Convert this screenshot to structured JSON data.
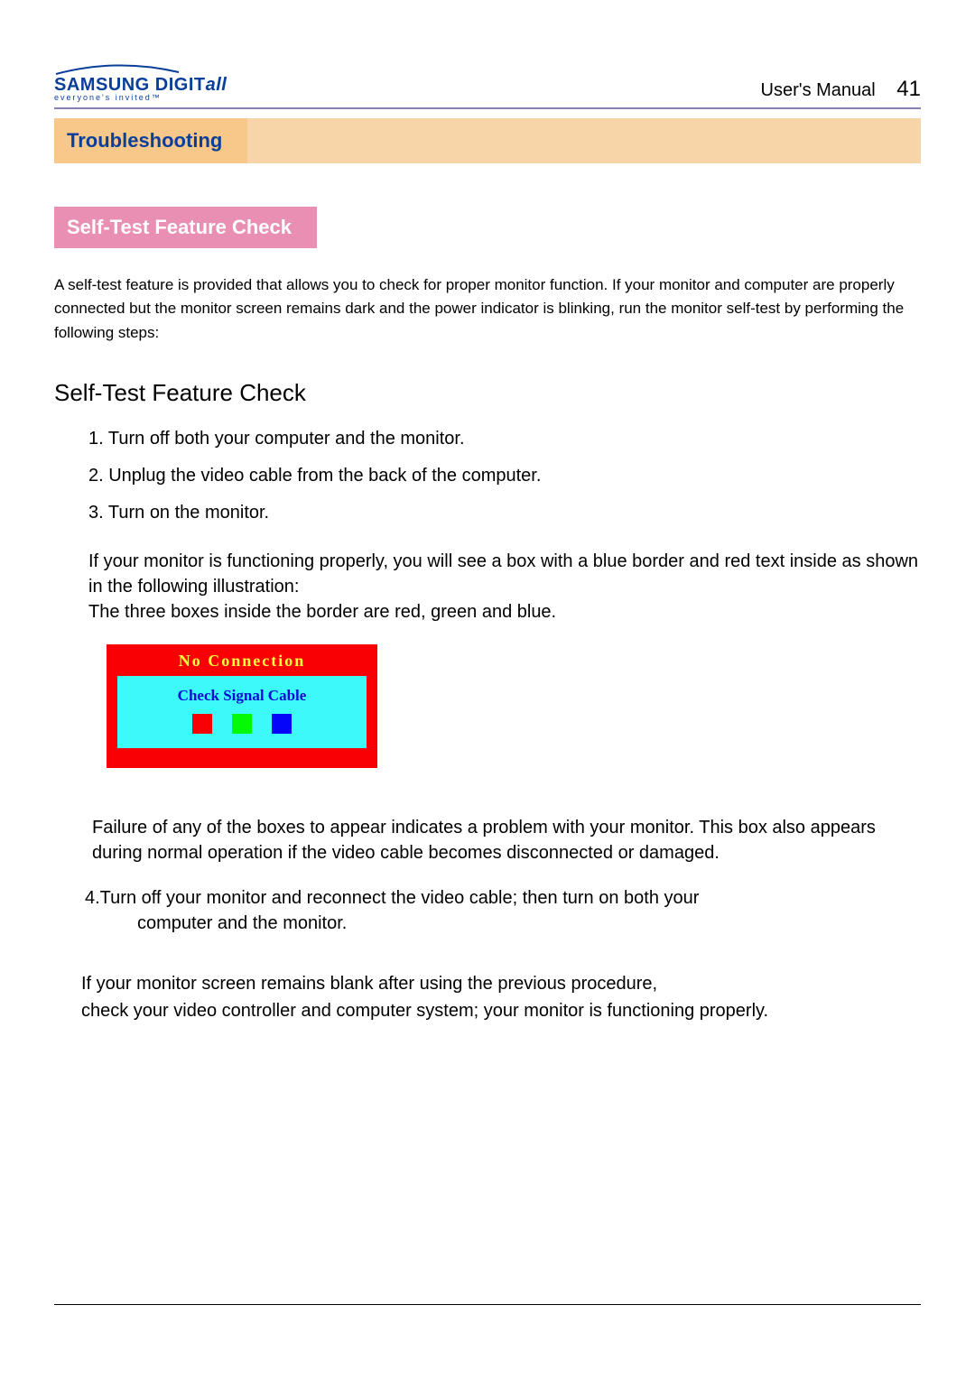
{
  "header": {
    "logo_brand": "SAMSUNG DIGIT",
    "logo_brand_suffix": "all",
    "logo_tagline": "everyone's invited™",
    "doc_title": "User's  Manual",
    "page_number": "41"
  },
  "section": {
    "title": "Troubleshooting"
  },
  "subhead": "Self-Test Feature Check",
  "intro": " A self-test feature is provided that allows you to check for proper monitor function. If your monitor and computer are properly connected but the monitor screen remains dark and the power indicator is blinking, run the monitor self-test by performing the following steps:",
  "heading2": "Self-Test Feature Check",
  "steps": {
    "s1": "1. Turn off both your computer and the monitor.",
    "s2": "2. Unplug the video cable from the back of the computer.",
    "s3": "3. Turn on the monitor."
  },
  "body1": "If your monitor is functioning properly, you will see a box with a blue border and red text inside as shown in the following illustration:",
  "body1b": "The three boxes inside the border are red, green and blue.",
  "diagram": {
    "title": "No Connection",
    "inner_title": "Check Signal Cable"
  },
  "failure": "Failure of any of the boxes to appear indicates a problem with your monitor. This box also appears during normal operation if the video cable becomes disconnected or damaged.",
  "step4_a": "4.Turn off your monitor and reconnect the video cable; then turn on both your",
  "step4_b": "computer and the monitor.",
  "final_a": "If your monitor screen remains blank after using the previous procedure,",
  "final_b": "check your video controller and computer system; your monitor is functioning properly."
}
